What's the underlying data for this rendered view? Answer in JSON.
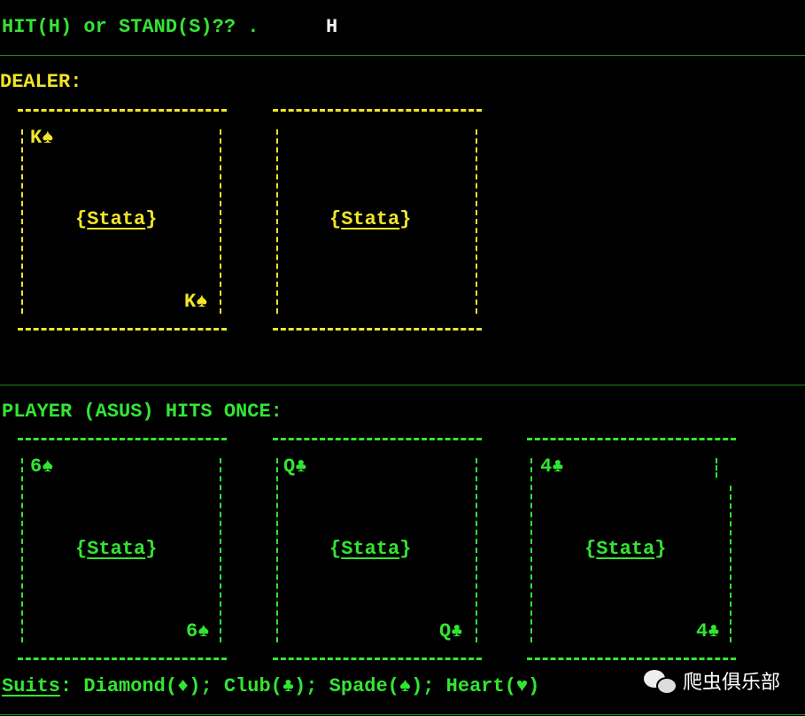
{
  "prompt": {
    "question": "HIT(H) or STAND(S)?? . ",
    "answer": "H"
  },
  "dealer": {
    "heading": "DEALER:",
    "cards": [
      {
        "rank_suit": "K♠",
        "face_up": true,
        "center": "{Stata}"
      },
      {
        "rank_suit": "",
        "face_up": false,
        "center": "{Stata}"
      }
    ]
  },
  "player": {
    "heading": "PLAYER (ASUS) HITS ONCE:",
    "cards": [
      {
        "rank_suit": "6♠",
        "center": "{Stata}"
      },
      {
        "rank_suit": "Q♣",
        "center": "{Stata}"
      },
      {
        "rank_suit": "4♣",
        "center": "{Stata}"
      }
    ]
  },
  "suits": {
    "label": "Suits",
    "text": ": Diamond(♦); Club(♣); Spade(♠); Heart(♥)"
  },
  "watermark": {
    "text": "爬虫俱乐部",
    "icon": "wechat-icon"
  },
  "colors": {
    "green": "#33e533",
    "yellow": "#f0e52a",
    "white": "#f2f2f2",
    "background": "#000000"
  }
}
